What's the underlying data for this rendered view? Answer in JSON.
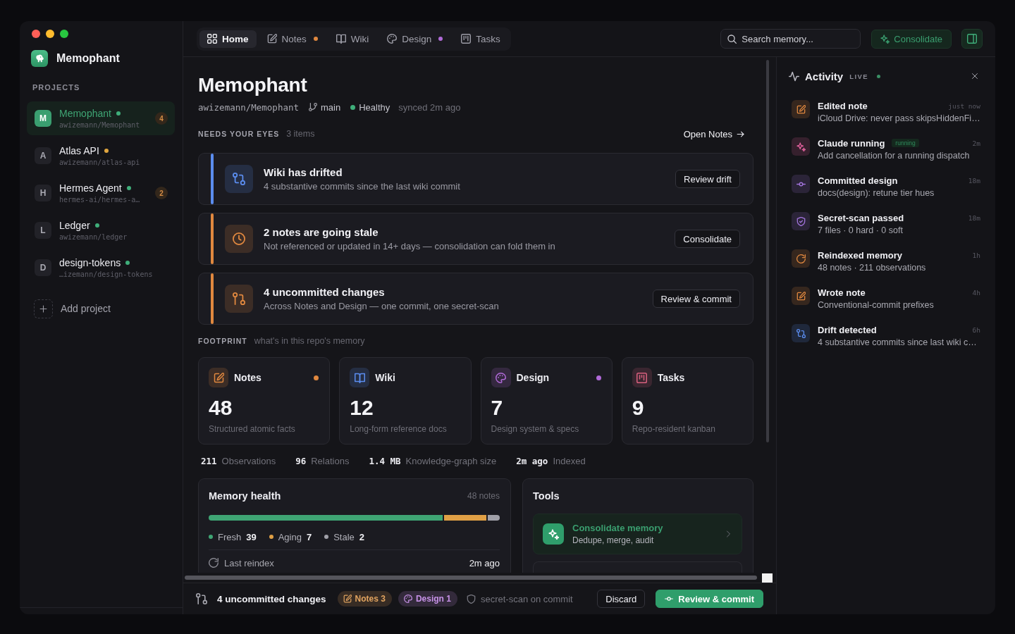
{
  "window_controls": [
    {
      "kind": "close"
    },
    {
      "kind": "minimize"
    },
    {
      "kind": "zoom"
    }
  ],
  "sidebar": {
    "app_name": "Memophant",
    "section_label": "PROJECTS",
    "projects": [
      {
        "initial": "M",
        "name": "Memophant",
        "repo": "awizemann/Memophant",
        "color": "#3fae7a",
        "badge": "4",
        "selected": true
      },
      {
        "initial": "A",
        "name": "Atlas API",
        "repo": "awizemann/atlas-api",
        "color": "#e0a53f",
        "selected": false
      },
      {
        "initial": "H",
        "name": "Hermes Agent",
        "repo": "hermes-ai/hermes-a…",
        "color": "#3fae7a",
        "badge": "2",
        "selected": false
      },
      {
        "initial": "L",
        "name": "Ledger",
        "repo": "awizemann/ledger",
        "color": "#3fae7a",
        "selected": false
      },
      {
        "initial": "D",
        "name": "design-tokens",
        "repo": "…izemann/design-tokens",
        "color": "#3fae7a",
        "selected": false
      }
    ],
    "add_label": "Add project"
  },
  "topbar": {
    "tabs": [
      {
        "kind": "home",
        "label": "Home",
        "selected": true
      },
      {
        "kind": "notes",
        "label": "Notes",
        "color": "#e0883f",
        "selected": false
      },
      {
        "kind": "wiki",
        "label": "Wiki",
        "selected": false
      },
      {
        "kind": "design",
        "label": "Design",
        "color": "#b06ad8",
        "selected": false
      },
      {
        "kind": "tasks",
        "label": "Tasks",
        "selected": false
      }
    ],
    "search": {
      "placeholder": "Search memory..."
    },
    "consolidate_button": "Consolidate",
    "panel_toggle": {
      "on": true
    }
  },
  "overview": {
    "title": "Memophant",
    "repo": "awizemann/Memophant",
    "branch": "main",
    "health": "Healthy",
    "synced": "synced 2m ago"
  },
  "needs_attention": {
    "label": "NEEDS YOUR EYES",
    "count": "3 items",
    "link": "Open Notes",
    "items": [
      {
        "kind": "drift",
        "color": "#5b8def",
        "title": "Wiki has drifted",
        "detail": "4 substantive commits since the last wiki commit",
        "action": "Review drift"
      },
      {
        "kind": "stale",
        "color": "#e0883f",
        "title": "2 notes are going stale",
        "detail": "Not referenced or updated in 14+ days — consolidation can fold them in",
        "action": "Consolidate"
      },
      {
        "kind": "changes",
        "color": "#e0883f",
        "title": "4 uncommitted changes",
        "detail": "Across Notes and Design — one commit, one secret-scan",
        "action": "Review & commit"
      }
    ]
  },
  "footprint": {
    "label": "FOOTPRINT",
    "caption": "what's in this repo's memory",
    "cards": [
      {
        "kind": "notes",
        "label": "Notes",
        "count": "48",
        "detail": "Structured atomic facts",
        "color": "#e0883f"
      },
      {
        "kind": "wiki",
        "label": "Wiki",
        "count": "12",
        "detail": "Long-form reference docs"
      },
      {
        "kind": "design",
        "label": "Design",
        "count": "7",
        "detail": "Design system & specs",
        "color": "#b06ad8"
      },
      {
        "kind": "tasks",
        "label": "Tasks",
        "count": "9",
        "detail": "Repo-resident kanban"
      }
    ],
    "stats": [
      {
        "value": "211",
        "label": "Observations"
      },
      {
        "value": "96",
        "label": "Relations"
      },
      {
        "value": "1.4 MB",
        "label": "Knowledge-graph size"
      },
      {
        "value": "2m ago",
        "label": "Indexed"
      }
    ]
  },
  "memory_health": {
    "title": "Memory health",
    "count": "48 notes",
    "segments": [
      {
        "label": "Fresh",
        "value": "39",
        "color": "#3fa574"
      },
      {
        "label": "Aging",
        "value": "7",
        "color": "#e0a045"
      },
      {
        "label": "Stale",
        "value": "2",
        "color": "#a0a0a8"
      }
    ],
    "reindex_label": "Last reindex",
    "reindex_time": "2m ago"
  },
  "tools": {
    "title": "Tools",
    "items": [
      {
        "label": "Consolidate memory",
        "detail": "Dedupe, merge, audit",
        "highlighted": true
      },
      {
        "highlighted": false
      }
    ]
  },
  "commit_bar": {
    "summary": "4 uncommitted changes",
    "chips": [
      {
        "kind": "notes",
        "label": "Notes 3"
      },
      {
        "kind": "design",
        "label": "Design 1"
      }
    ],
    "scan_note": "secret-scan on commit",
    "discard": "Discard",
    "commit": "Review & commit"
  },
  "activity": {
    "title": "Activity",
    "live_label": "LIVE",
    "items": [
      {
        "kind": "note",
        "title": "Edited note",
        "detail": "iCloud Drive: never pass skipsHiddenFi…",
        "time": "just now"
      },
      {
        "kind": "sparkle",
        "title": "Claude running",
        "badge": "running",
        "detail": "Add cancellation for a running dispatch",
        "time": "2m"
      },
      {
        "kind": "commit",
        "title": "Committed design",
        "detail": "docs(design): retune tier hues",
        "time": "18m"
      },
      {
        "kind": "shield",
        "title": "Secret-scan passed",
        "detail": "7 files · 0 hard · 0 soft",
        "time": "18m"
      },
      {
        "kind": "refresh",
        "title": "Reindexed memory",
        "detail": "48 notes · 211 observations",
        "time": "1h"
      },
      {
        "kind": "note",
        "title": "Wrote note",
        "detail": "Conventional-commit prefixes",
        "time": "4h"
      },
      {
        "kind": "compare",
        "title": "Drift detected",
        "detail": "4 substantive commits since last wiki c…",
        "time": "6h"
      }
    ]
  }
}
